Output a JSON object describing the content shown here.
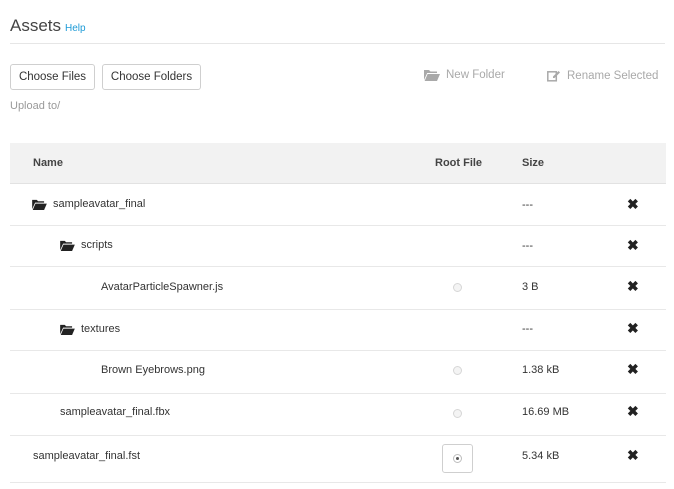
{
  "header": {
    "title": "Assets",
    "help": "Help"
  },
  "toolbar": {
    "choose_files": "Choose Files",
    "choose_folders": "Choose Folders",
    "new_folder": "New Folder",
    "rename_selected": "Rename Selected"
  },
  "upload": {
    "label": "Upload to/"
  },
  "table": {
    "columns": {
      "name": "Name",
      "root_file": "Root File",
      "size": "Size"
    },
    "rows": [
      {
        "name": "sampleavatar_final",
        "type": "folder",
        "size": "---"
      },
      {
        "name": "scripts",
        "type": "folder",
        "size": "---"
      },
      {
        "name": "AvatarParticleSpawner.js",
        "type": "file",
        "size": "3 B",
        "root": false
      },
      {
        "name": "textures",
        "type": "folder",
        "size": "---"
      },
      {
        "name": "Brown Eyebrows.png",
        "type": "file",
        "size": "1.38 kB",
        "root": false
      },
      {
        "name": "sampleavatar_final.fbx",
        "type": "file",
        "size": "16.69 MB",
        "root": false
      },
      {
        "name": "sampleavatar_final.fst",
        "type": "file",
        "size": "5.34 kB",
        "root": true
      }
    ],
    "delete_glyph": "✖"
  },
  "colors": {
    "accent": "#1c9ad6",
    "header_bg": "#f2f2f2",
    "muted": "#a9a9a9"
  },
  "icons": {
    "folder": "folder-open-icon",
    "folder_plus": "folder-plus-icon",
    "rename": "edit-icon",
    "delete": "close-icon"
  }
}
